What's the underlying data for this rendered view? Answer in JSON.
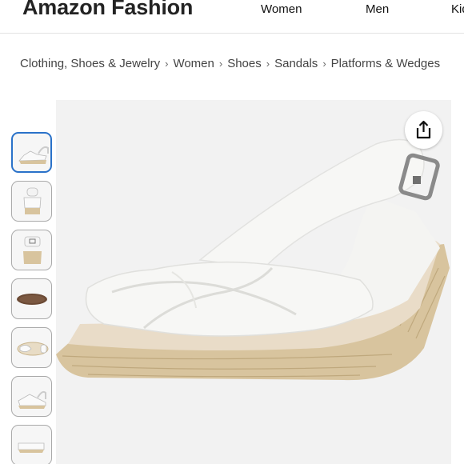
{
  "header": {
    "brand": "Amazon Fashion",
    "nav": [
      "Women",
      "Men",
      "Kids"
    ]
  },
  "breadcrumb": [
    "Clothing, Shoes & Jewelry",
    "Women",
    "Shoes",
    "Sandals",
    "Platforms & Wedges"
  ],
  "breadcrumb_separator": "›",
  "product": {
    "thumbnail_count": 7,
    "selected_thumbnail": 1,
    "main_image": "white-espadrille-wedge-sandal",
    "share_icon": "share-icon"
  },
  "colors": {
    "accent": "#2a72c9",
    "image_background": "#f2f2f2",
    "shoe_upper": "#f7f7f5",
    "jute": "#d8c49e"
  }
}
